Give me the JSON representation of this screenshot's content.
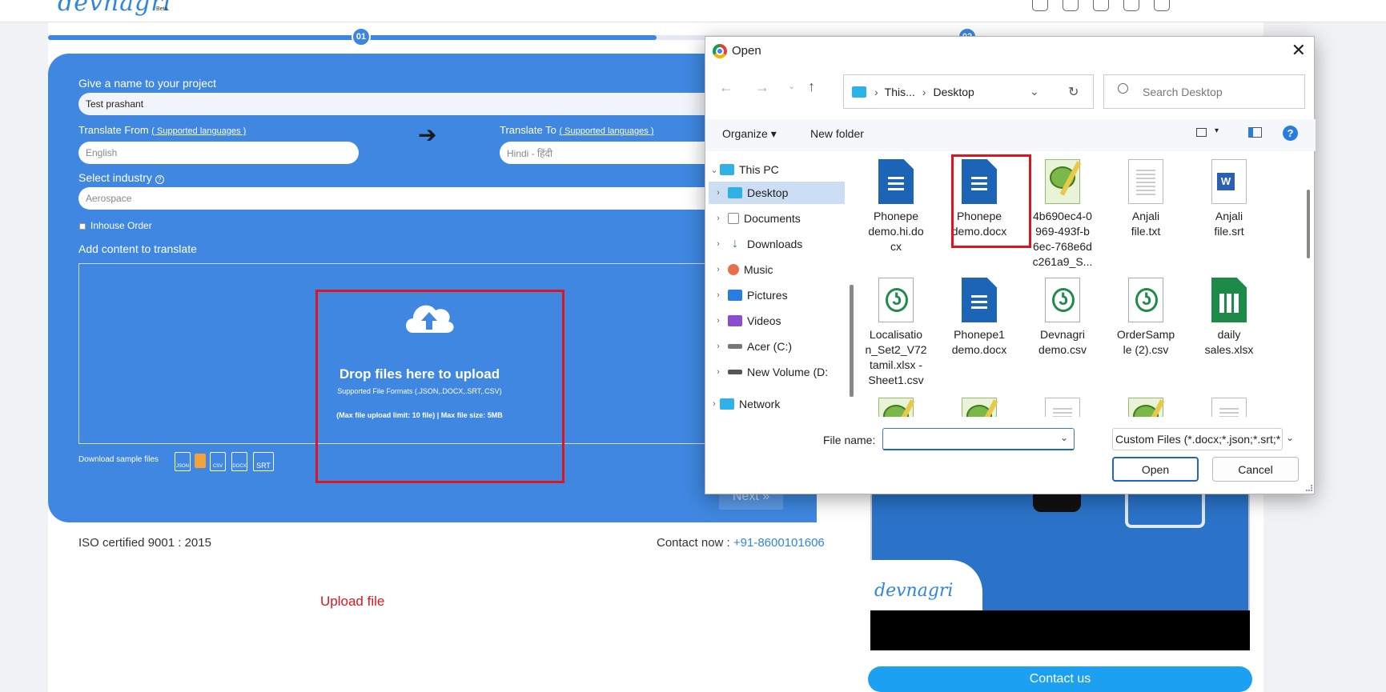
{
  "app": {
    "logo_text": "devnagri",
    "logo_badge": "Beta"
  },
  "progress": {
    "percent": 65,
    "step1": "01",
    "step2": "02"
  },
  "form": {
    "project_name_label": "Give a name to your project",
    "project_name_value": "Test prashant",
    "translate_from_label": "Translate From",
    "translate_from_link": "( Supported languages )",
    "translate_from_value": "English",
    "translate_to_label": "Translate To",
    "translate_to_link": "( Supported languages )",
    "translate_to_value": "Hindi - हिंदी",
    "industry_label": "Select industry",
    "industry_value": "Aerospace",
    "inhouse_label": "Inhouse Order",
    "content_label": "Add content to translate",
    "drop_title": "Drop files here to upload",
    "drop_formats": "Supported File Formats (.JSON,.DOCX,.SRT,.CSV)",
    "drop_limits": "(Max file upload limit: 10 file) | Max file size: 5MB",
    "sample_label": "Download sample files",
    "sample_icons": [
      "JSON",
      "",
      "CSV",
      "DOCX",
      "SRT"
    ],
    "next_label": "Next"
  },
  "footer": {
    "iso": "ISO certified 9001 : 2015",
    "contact_prefix": "Contact now :",
    "contact_phone": "+91-8600101606",
    "annotation": "Upload file"
  },
  "sidebar": {
    "contact_us": "Contact us",
    "video_logo": "devnagri"
  },
  "dialog": {
    "title": "Open",
    "close": "✕",
    "path": [
      "This...",
      "Desktop"
    ],
    "search_placeholder": "Search Desktop",
    "organize": "Organize",
    "new_folder": "New folder",
    "tree": [
      {
        "label": "This PC",
        "icon": "computer-icon"
      },
      {
        "label": "Desktop",
        "icon": "desktop-folder-icon"
      },
      {
        "label": "Documents",
        "icon": "documents-icon"
      },
      {
        "label": "Downloads",
        "icon": "downloads-icon"
      },
      {
        "label": "Music",
        "icon": "music-icon"
      },
      {
        "label": "Pictures",
        "icon": "pictures-icon"
      },
      {
        "label": "Videos",
        "icon": "videos-icon"
      },
      {
        "label": "Acer (C:)",
        "icon": "drive-icon"
      },
      {
        "label": "New Volume (D:",
        "icon": "drive-icon"
      },
      {
        "label": "Network",
        "icon": "network-icon"
      }
    ],
    "files": [
      {
        "name": "Phonepe demo.hi.docx",
        "lines": [
          "Phonepe",
          "demo.hi.do",
          "cx"
        ],
        "type": "docx"
      },
      {
        "name": "Phonepe demo.docx",
        "lines": [
          "Phonepe",
          "demo.docx"
        ],
        "type": "docx"
      },
      {
        "name": "4b690ec4-0969-493f-b6ec-768e6dc261a9_S...",
        "lines": [
          "4b690ec4-0",
          "969-493f-b",
          "6ec-768e6d",
          "c261a9_S..."
        ],
        "type": "notepadpp"
      },
      {
        "name": "Anjali file.txt",
        "lines": [
          "Anjali",
          "file.txt"
        ],
        "type": "txt"
      },
      {
        "name": "Anjali file.srt",
        "lines": [
          "Anjali",
          "file.srt"
        ],
        "type": "word"
      },
      {
        "name": "Localisation_Set2_V72tamil.xlsx - Sheet1.csv",
        "lines": [
          "Localisatio",
          "n_Set2_V72",
          "tamil.xlsx -",
          "Sheet1.csv"
        ],
        "type": "csv"
      },
      {
        "name": "Phonepe1 demo.docx",
        "lines": [
          "Phonepe1",
          "demo.docx"
        ],
        "type": "docx"
      },
      {
        "name": "Devnagri demo.csv",
        "lines": [
          "Devnagri",
          "demo.csv"
        ],
        "type": "csv"
      },
      {
        "name": "OrderSample (2).csv",
        "lines": [
          "OrderSamp",
          "le (2).csv"
        ],
        "type": "csv"
      },
      {
        "name": "daily sales.xlsx",
        "lines": [
          "daily",
          "sales.xlsx"
        ],
        "type": "xlsx"
      }
    ],
    "file_name_label": "File name:",
    "file_name_value": "",
    "filter_value": "Custom Files (*.docx;*.json;*.srt;*",
    "open_label": "Open",
    "cancel_label": "Cancel"
  },
  "colors": {
    "panel_blue": "#3f87e0",
    "highlight_red": "#e0141c",
    "contact_button": "#1ba0f2"
  }
}
